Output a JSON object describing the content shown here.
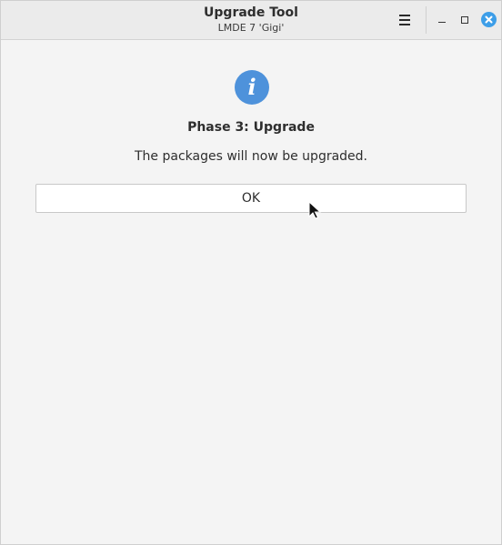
{
  "window": {
    "title": "Upgrade Tool",
    "subtitle": "LMDE 7 'Gigi'"
  },
  "titlebar_icons": {
    "menu": "hamburger-menu-icon",
    "minimize": "minimize-icon",
    "maximize": "maximize-icon",
    "close": "close-icon",
    "close_color": "#3d9ee8"
  },
  "dialog": {
    "icon": "info-icon",
    "icon_color": "#4e92db",
    "icon_glyph": "i",
    "heading": "Phase 3: Upgrade",
    "message": "The packages will now be upgraded.",
    "ok_label": "OK"
  },
  "cursor": {
    "icon": "mouse-pointer-icon"
  }
}
